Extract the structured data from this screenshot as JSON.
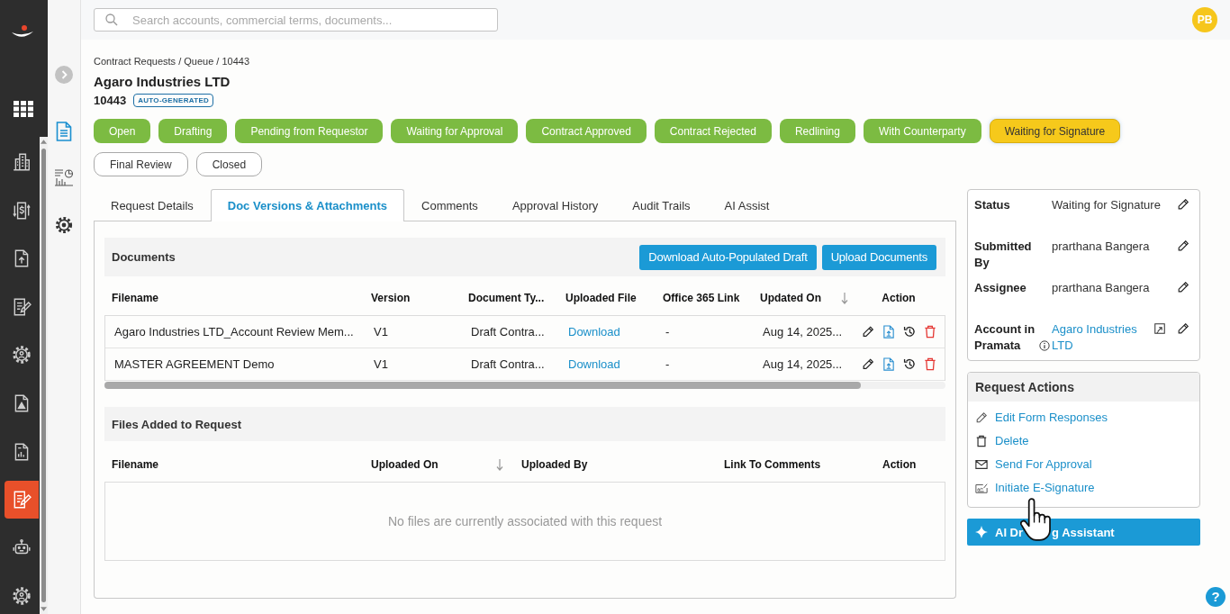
{
  "sidebar": {
    "items": [
      {
        "selected": false
      },
      {
        "selected": false
      },
      {
        "selected": false
      },
      {
        "selected": false
      },
      {
        "selected": false
      },
      {
        "selected": false
      },
      {
        "selected": false
      },
      {
        "selected": true
      },
      {
        "selected": false
      },
      {
        "selected": false
      }
    ]
  },
  "subnav": {
    "items": [
      {
        "selected": true
      },
      {
        "selected": false
      },
      {
        "selected": false
      }
    ]
  },
  "search": {
    "placeholder": "Search accounts, commercial terms, documents..."
  },
  "user": {
    "initials": "PB"
  },
  "breadcrumb": "Contract Requests / Queue / 10443",
  "title": "Agaro Industries LTD",
  "request_id": "10443",
  "id_badge": "AUTO-GENERATED",
  "status_steps": [
    {
      "label": "Open",
      "completed": true,
      "selected": false
    },
    {
      "label": "Drafting",
      "completed": true,
      "selected": false
    },
    {
      "label": "Pending from Requestor",
      "completed": true,
      "selected": false
    },
    {
      "label": "Waiting for Approval",
      "completed": true,
      "selected": false
    },
    {
      "label": "Contract Approved",
      "completed": true,
      "selected": false
    },
    {
      "label": "Contract Rejected",
      "completed": true,
      "selected": false
    },
    {
      "label": "Redlining",
      "completed": true,
      "selected": false
    },
    {
      "label": "With Counterparty",
      "completed": true,
      "selected": false
    },
    {
      "label": "Waiting for Signature",
      "completed": false,
      "selected": true
    },
    {
      "label": "Final Review",
      "completed": false,
      "selected": false
    },
    {
      "label": "Closed",
      "completed": false,
      "selected": false
    }
  ],
  "tabs": [
    {
      "label": "Request Details",
      "selected": false
    },
    {
      "label": "Doc Versions & Attachments",
      "selected": true
    },
    {
      "label": "Comments",
      "selected": false
    },
    {
      "label": "Approval History",
      "selected": false
    },
    {
      "label": "Audit Trails",
      "selected": false
    },
    {
      "label": "AI Assist",
      "selected": false
    }
  ],
  "documents": {
    "title": "Documents",
    "buttons": [
      "Download Auto-Populated Draft",
      "Upload Documents"
    ],
    "columns": [
      "Filename",
      "Version",
      "Document Ty...",
      "Uploaded File",
      "Office 365 Link",
      "Updated On",
      "Action"
    ],
    "rows": [
      {
        "filename": "Agaro Industries LTD_Account Review Mem...",
        "version": "V1",
        "document_type": "Draft Contra...",
        "uploaded_file": "Download",
        "office_365_link": "-",
        "updated_on": "Aug 14, 2025..."
      },
      {
        "filename": "MASTER AGREEMENT Demo",
        "version": "V1",
        "document_type": "Draft Contra...",
        "uploaded_file": "Download",
        "office_365_link": "-",
        "updated_on": "Aug 14, 2025..."
      }
    ]
  },
  "files": {
    "title": "Files Added to Request",
    "columns": [
      "Filename",
      "Uploaded On",
      "Uploaded By",
      "Link To Comments",
      "Action"
    ],
    "empty_message": "No files are currently associated with this request"
  },
  "details": [
    {
      "label": "Status",
      "value": "Waiting for Signature",
      "kind": "text"
    },
    {
      "label": "Submitted By",
      "value": "prarthana Bangera",
      "kind": "text"
    },
    {
      "label": "Assignee",
      "value": "prarthana Bangera",
      "kind": "text"
    },
    {
      "label": "Account in Pramata",
      "value": "Agaro Industries LTD",
      "kind": "link"
    }
  ],
  "request_actions": {
    "title": "Request Actions",
    "items": [
      "Edit Form Responses",
      "Delete",
      "Send For Approval",
      "Initiate E-Signature"
    ]
  },
  "assistant_button": {
    "label_start": "AI Dr",
    "label_end": "g Assistant"
  },
  "help_button": {
    "label": "?"
  }
}
